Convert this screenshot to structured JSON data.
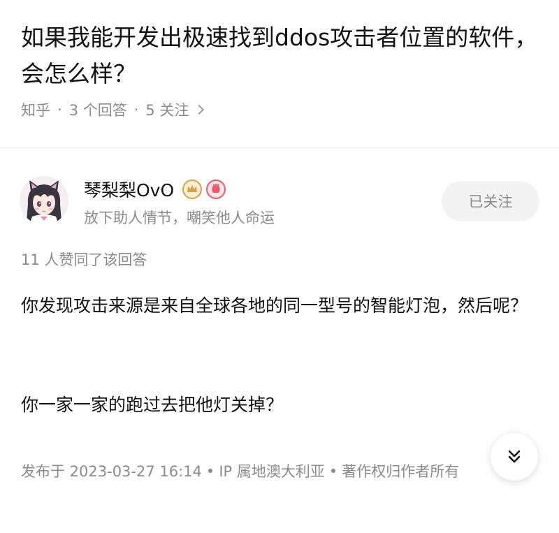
{
  "question": {
    "title": "如果我能开发出极速找到ddos攻击者位置的软件，会怎么样？",
    "source": "知乎",
    "answers": "3 个回答",
    "follows": "5 关注",
    "chevron_icon": "chevron-right-icon"
  },
  "author": {
    "name": "琴梨梨OvO",
    "bio": "放下助人情节，嘲笑他人命运",
    "follow_label": "已关注",
    "badges": [
      "crown-badge-icon",
      "fist-badge-icon"
    ],
    "badge_colors": [
      "#d4a24c",
      "#e85a6a"
    ]
  },
  "answer": {
    "agree_text": "11 人赞同了该回答",
    "paragraphs": [
      "你发现攻击来源是来自全球各地的同一型号的智能灯泡，然后呢？",
      "你一家一家的跑过去把他灯关掉？"
    ],
    "footer_date": "发布于 2023-03-27 16:14",
    "footer_ip": "IP 属地澳大利亚",
    "footer_copyright": "著作权归作者所有",
    "footer_sep": "•"
  },
  "colors": {
    "text_primary": "#121212",
    "text_secondary": "#8b8b8b",
    "button_bg": "#f3f3f3"
  }
}
